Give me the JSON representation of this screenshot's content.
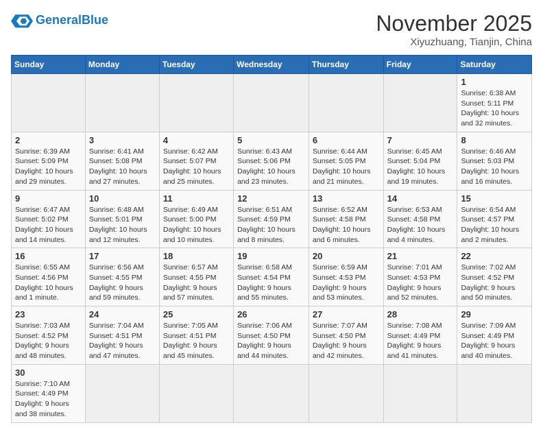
{
  "header": {
    "logo_general": "General",
    "logo_blue": "Blue",
    "month_title": "November 2025",
    "location": "Xiyuzhuang, Tianjin, China"
  },
  "weekdays": [
    "Sunday",
    "Monday",
    "Tuesday",
    "Wednesday",
    "Thursday",
    "Friday",
    "Saturday"
  ],
  "weeks": [
    [
      {
        "day": "",
        "info": ""
      },
      {
        "day": "",
        "info": ""
      },
      {
        "day": "",
        "info": ""
      },
      {
        "day": "",
        "info": ""
      },
      {
        "day": "",
        "info": ""
      },
      {
        "day": "",
        "info": ""
      },
      {
        "day": "1",
        "info": "Sunrise: 6:38 AM\nSunset: 5:11 PM\nDaylight: 10 hours and 32 minutes."
      }
    ],
    [
      {
        "day": "2",
        "info": "Sunrise: 6:39 AM\nSunset: 5:09 PM\nDaylight: 10 hours and 29 minutes."
      },
      {
        "day": "3",
        "info": "Sunrise: 6:41 AM\nSunset: 5:08 PM\nDaylight: 10 hours and 27 minutes."
      },
      {
        "day": "4",
        "info": "Sunrise: 6:42 AM\nSunset: 5:07 PM\nDaylight: 10 hours and 25 minutes."
      },
      {
        "day": "5",
        "info": "Sunrise: 6:43 AM\nSunset: 5:06 PM\nDaylight: 10 hours and 23 minutes."
      },
      {
        "day": "6",
        "info": "Sunrise: 6:44 AM\nSunset: 5:05 PM\nDaylight: 10 hours and 21 minutes."
      },
      {
        "day": "7",
        "info": "Sunrise: 6:45 AM\nSunset: 5:04 PM\nDaylight: 10 hours and 19 minutes."
      },
      {
        "day": "8",
        "info": "Sunrise: 6:46 AM\nSunset: 5:03 PM\nDaylight: 10 hours and 16 minutes."
      }
    ],
    [
      {
        "day": "9",
        "info": "Sunrise: 6:47 AM\nSunset: 5:02 PM\nDaylight: 10 hours and 14 minutes."
      },
      {
        "day": "10",
        "info": "Sunrise: 6:48 AM\nSunset: 5:01 PM\nDaylight: 10 hours and 12 minutes."
      },
      {
        "day": "11",
        "info": "Sunrise: 6:49 AM\nSunset: 5:00 PM\nDaylight: 10 hours and 10 minutes."
      },
      {
        "day": "12",
        "info": "Sunrise: 6:51 AM\nSunset: 4:59 PM\nDaylight: 10 hours and 8 minutes."
      },
      {
        "day": "13",
        "info": "Sunrise: 6:52 AM\nSunset: 4:58 PM\nDaylight: 10 hours and 6 minutes."
      },
      {
        "day": "14",
        "info": "Sunrise: 6:53 AM\nSunset: 4:58 PM\nDaylight: 10 hours and 4 minutes."
      },
      {
        "day": "15",
        "info": "Sunrise: 6:54 AM\nSunset: 4:57 PM\nDaylight: 10 hours and 2 minutes."
      }
    ],
    [
      {
        "day": "16",
        "info": "Sunrise: 6:55 AM\nSunset: 4:56 PM\nDaylight: 10 hours and 1 minute."
      },
      {
        "day": "17",
        "info": "Sunrise: 6:56 AM\nSunset: 4:55 PM\nDaylight: 9 hours and 59 minutes."
      },
      {
        "day": "18",
        "info": "Sunrise: 6:57 AM\nSunset: 4:55 PM\nDaylight: 9 hours and 57 minutes."
      },
      {
        "day": "19",
        "info": "Sunrise: 6:58 AM\nSunset: 4:54 PM\nDaylight: 9 hours and 55 minutes."
      },
      {
        "day": "20",
        "info": "Sunrise: 6:59 AM\nSunset: 4:53 PM\nDaylight: 9 hours and 53 minutes."
      },
      {
        "day": "21",
        "info": "Sunrise: 7:01 AM\nSunset: 4:53 PM\nDaylight: 9 hours and 52 minutes."
      },
      {
        "day": "22",
        "info": "Sunrise: 7:02 AM\nSunset: 4:52 PM\nDaylight: 9 hours and 50 minutes."
      }
    ],
    [
      {
        "day": "23",
        "info": "Sunrise: 7:03 AM\nSunset: 4:52 PM\nDaylight: 9 hours and 48 minutes."
      },
      {
        "day": "24",
        "info": "Sunrise: 7:04 AM\nSunset: 4:51 PM\nDaylight: 9 hours and 47 minutes."
      },
      {
        "day": "25",
        "info": "Sunrise: 7:05 AM\nSunset: 4:51 PM\nDaylight: 9 hours and 45 minutes."
      },
      {
        "day": "26",
        "info": "Sunrise: 7:06 AM\nSunset: 4:50 PM\nDaylight: 9 hours and 44 minutes."
      },
      {
        "day": "27",
        "info": "Sunrise: 7:07 AM\nSunset: 4:50 PM\nDaylight: 9 hours and 42 minutes."
      },
      {
        "day": "28",
        "info": "Sunrise: 7:08 AM\nSunset: 4:49 PM\nDaylight: 9 hours and 41 minutes."
      },
      {
        "day": "29",
        "info": "Sunrise: 7:09 AM\nSunset: 4:49 PM\nDaylight: 9 hours and 40 minutes."
      }
    ],
    [
      {
        "day": "30",
        "info": "Sunrise: 7:10 AM\nSunset: 4:49 PM\nDaylight: 9 hours and 38 minutes."
      },
      {
        "day": "",
        "info": ""
      },
      {
        "day": "",
        "info": ""
      },
      {
        "day": "",
        "info": ""
      },
      {
        "day": "",
        "info": ""
      },
      {
        "day": "",
        "info": ""
      },
      {
        "day": "",
        "info": ""
      }
    ]
  ]
}
